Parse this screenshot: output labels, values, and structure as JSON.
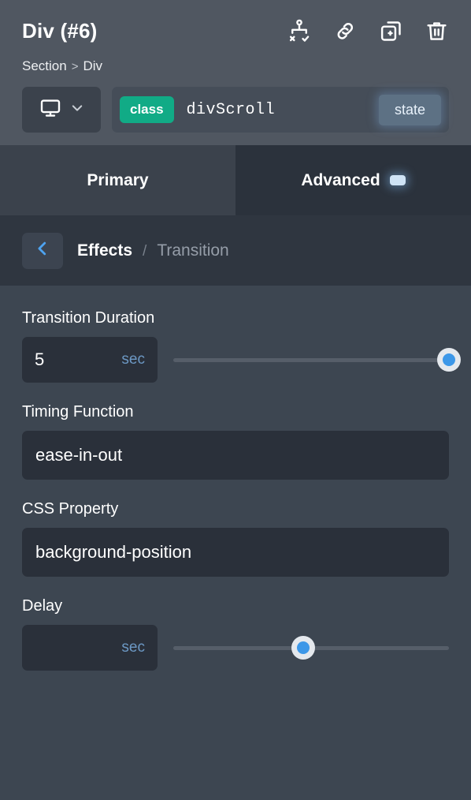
{
  "header": {
    "title": "Div (#6)",
    "icons": [
      {
        "name": "sitemap-validate-icon",
        "label": "sitemap"
      },
      {
        "name": "link-icon",
        "label": "link"
      },
      {
        "name": "duplicate-icon",
        "label": "duplicate"
      },
      {
        "name": "trash-icon",
        "label": "delete"
      }
    ],
    "breadcrumb": {
      "parent": "Section",
      "separator": ">",
      "current": "Div"
    },
    "selector": {
      "device_icon": "desktop-icon",
      "dropdown_icon": "chevron-down-icon",
      "class_chip_label": "class",
      "class_value": "divScroll",
      "state_label": "state"
    }
  },
  "tabs": [
    {
      "label": "Primary",
      "active": false,
      "badge": false
    },
    {
      "label": "Advanced",
      "active": true,
      "badge": true
    }
  ],
  "subbar": {
    "back_icon": "chevron-left-icon",
    "parent": "Effects",
    "separator": "/",
    "current": "Transition"
  },
  "fields": {
    "transition_duration": {
      "label": "Transition Duration",
      "value": "5",
      "unit": "sec",
      "slider_percent": 100
    },
    "timing_function": {
      "label": "Timing Function",
      "value": "ease-in-out"
    },
    "css_property": {
      "label": "CSS Property",
      "value": "background-position"
    },
    "delay": {
      "label": "Delay",
      "value": "",
      "unit": "sec",
      "slider_percent": 47
    }
  },
  "colors": {
    "panel_bg": "#3d4651",
    "header_bg": "#505761",
    "tab_active_bg": "#2b323c",
    "tab_inactive_bg": "#3b424c",
    "subbar_bg": "#2f3640",
    "input_bg": "#2a303a",
    "accent_green": "#11ab86",
    "accent_blue": "#3c97e8",
    "unit_text": "#6c98c4",
    "state_chip_bg": "#5d7184"
  }
}
